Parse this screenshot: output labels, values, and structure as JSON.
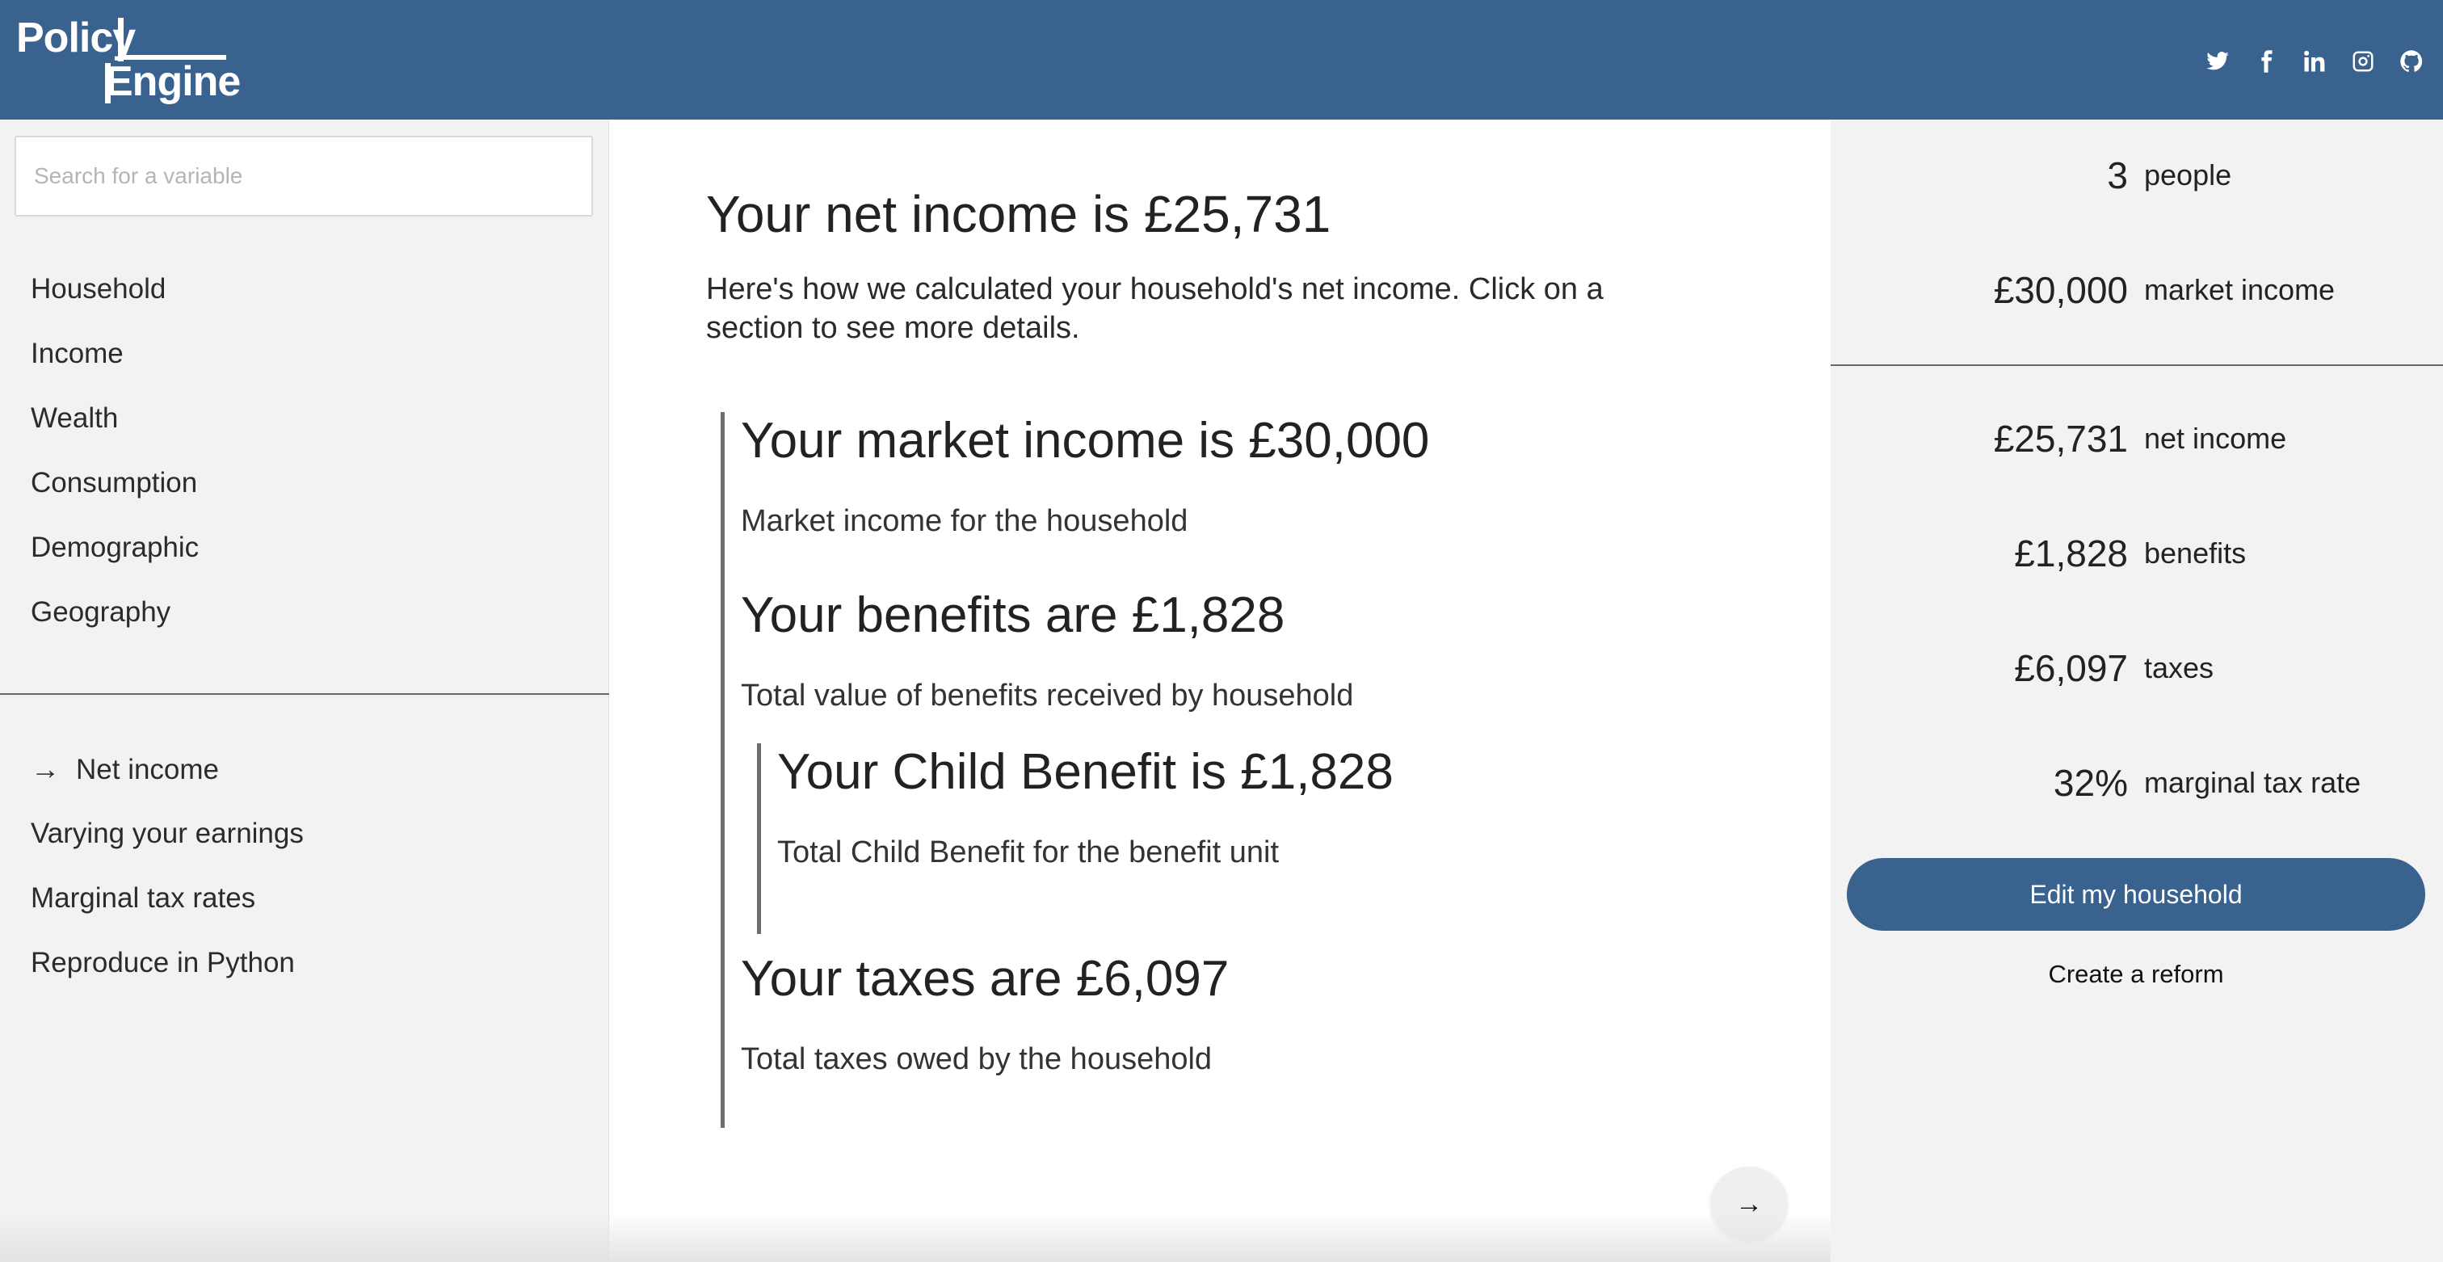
{
  "header": {
    "logo_line1": "Policy",
    "logo_line2": "Engine",
    "social_icons": [
      "twitter-icon",
      "facebook-icon",
      "linkedin-icon",
      "instagram-icon",
      "github-icon"
    ]
  },
  "sidebar": {
    "search_placeholder": "Search for a variable",
    "sections": [
      {
        "label": "Household"
      },
      {
        "label": "Income"
      },
      {
        "label": "Wealth"
      },
      {
        "label": "Consumption"
      },
      {
        "label": "Demographic"
      },
      {
        "label": "Geography"
      }
    ],
    "outputs": [
      {
        "label": "Net income",
        "active": true
      },
      {
        "label": "Varying your earnings"
      },
      {
        "label": "Marginal tax rates"
      },
      {
        "label": "Reproduce in Python"
      }
    ]
  },
  "main": {
    "title": "Your net income is £25,731",
    "intro": "Here's how we calculated your household's net income. Click on a section to see more details.",
    "market_income": {
      "title": "Your market income is £30,000",
      "desc": "Market income for the household"
    },
    "benefits": {
      "title": "Your benefits are £1,828",
      "desc": "Total value of benefits received by household"
    },
    "child_benefit": {
      "title": "Your Child Benefit is £1,828",
      "desc": "Total Child Benefit for the benefit unit"
    },
    "taxes": {
      "title": "Your taxes are £6,097",
      "desc": "Total taxes owed by the household"
    },
    "next_arrow": "→"
  },
  "summary": {
    "people": {
      "value": "3",
      "label": "people"
    },
    "market_income": {
      "value": "£30,000",
      "label": "market income"
    },
    "net_income": {
      "value": "£25,731",
      "label": "net income"
    },
    "benefits": {
      "value": "£1,828",
      "label": "benefits"
    },
    "taxes": {
      "value": "£6,097",
      "label": "taxes"
    },
    "mtr": {
      "value": "32%",
      "label": "marginal tax rate"
    },
    "edit_button": "Edit my household",
    "reform_link": "Create a reform"
  },
  "colors": {
    "brand_blue": "#39628f",
    "panel_gray": "#f2f2f2"
  }
}
